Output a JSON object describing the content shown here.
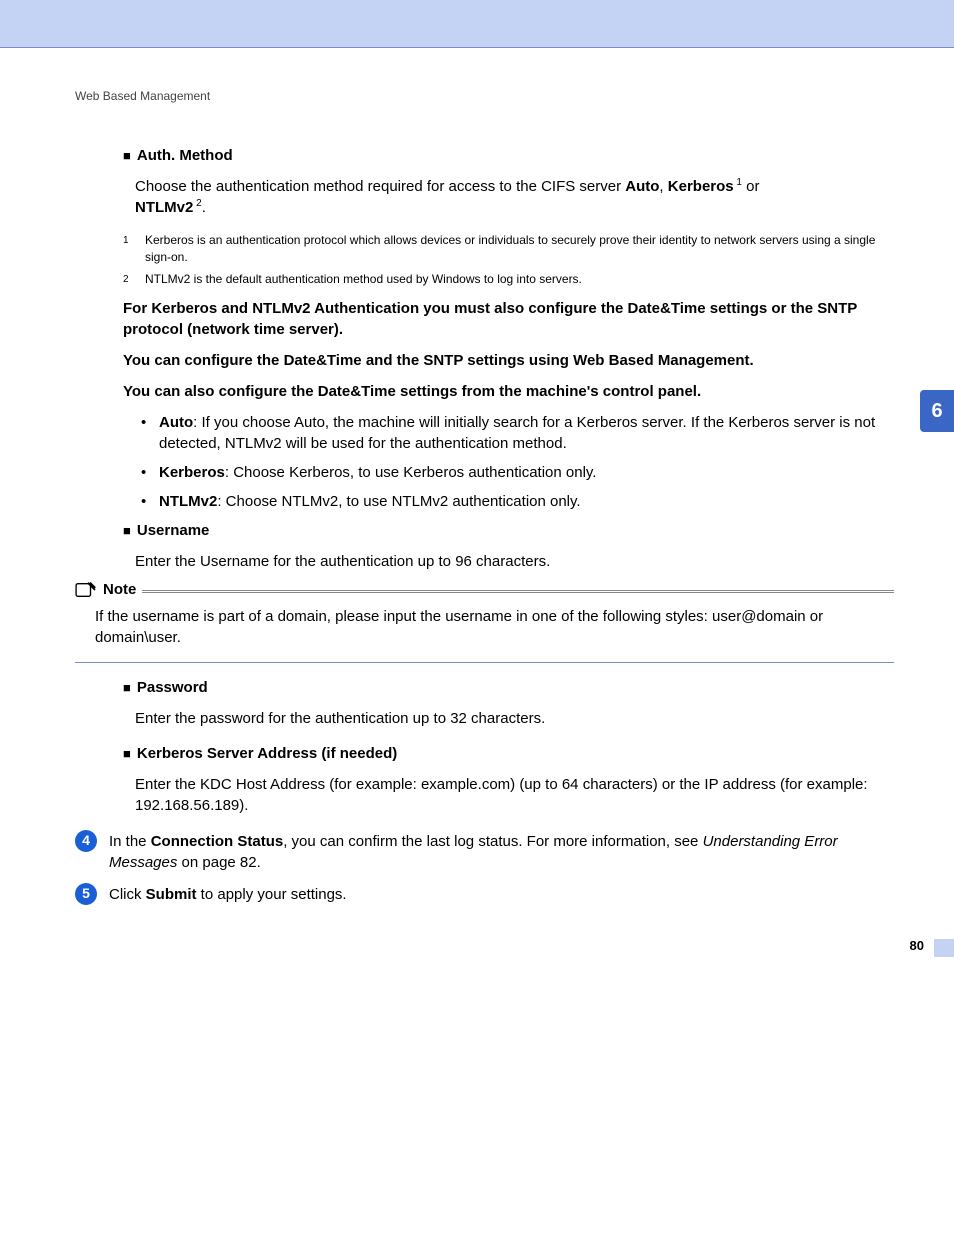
{
  "runningHead": "Web Based Management",
  "chapterTab": "6",
  "pageNumber": "80",
  "authMethod": {
    "title": "Auth. Method",
    "intro_a": "Choose the authentication method required for access to the CIFS server ",
    "intro_auto": "Auto",
    "intro_b": ", ",
    "intro_kerb": "Kerberos",
    "intro_c": " or ",
    "intro_ntlm": "NTLMv2",
    "intro_d": "."
  },
  "footnotes": {
    "n1": "1",
    "t1": "Kerberos is an authentication protocol which allows devices or individuals to securely prove their identity to network servers using a single sign-on.",
    "n2": "2",
    "t2": "NTLMv2 is the default authentication method used by Windows to log into servers."
  },
  "bold1": "For Kerberos and NTLMv2 Authentication you must also configure the Date&Time settings or the SNTP protocol (network time server).",
  "bold2": "You can configure the Date&Time and the SNTP settings using Web Based Management.",
  "bold3": "You can also configure the Date&Time settings from the machine's control panel.",
  "bullets": {
    "auto_b": "Auto",
    "auto_t": ": If you choose Auto, the machine will initially search for a Kerberos server. If the Kerberos server is not detected, NTLMv2 will be used for the authentication method.",
    "kerb_b": "Kerberos",
    "kerb_t": ": Choose Kerberos, to use Kerberos authentication only.",
    "ntlm_b": "NTLMv2",
    "ntlm_t": ": Choose NTLMv2, to use NTLMv2 authentication only."
  },
  "username": {
    "title": "Username",
    "text": "Enter the Username for the authentication up to 96 characters."
  },
  "note": {
    "title": "Note",
    "text": "If the username is part of a domain, please input the username in one of the following styles: user@domain or domain\\user."
  },
  "password": {
    "title": "Password",
    "text": "Enter the password for the authentication up to 32 characters."
  },
  "ksa": {
    "title": "Kerberos Server Address",
    "suffix": " (if needed)",
    "text": "Enter the KDC Host Address (for example: example.com) (up to 64 characters) or the IP address (for example: 192.168.56.189)."
  },
  "step4": {
    "num": "4",
    "a": "In the ",
    "b": "Connection Status",
    "c": ", you can confirm the last log status. For more information, see ",
    "d": "Understanding Error Messages",
    "e": " on page 82."
  },
  "step5": {
    "num": "5",
    "a": "Click ",
    "b": "Submit",
    "c": " to apply your settings."
  }
}
